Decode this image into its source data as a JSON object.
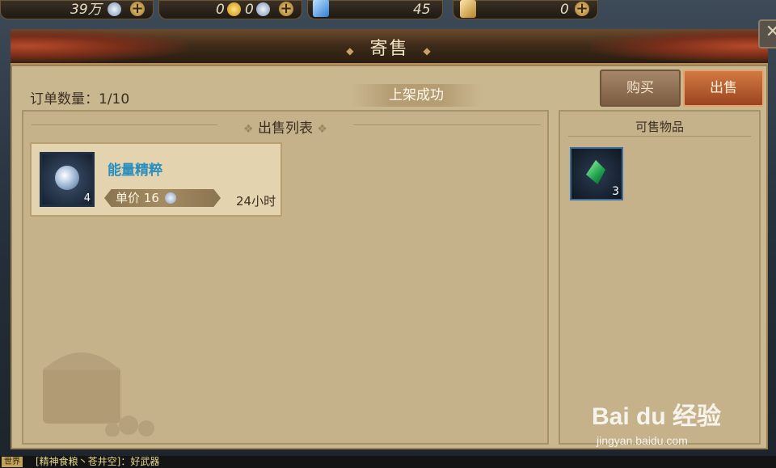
{
  "topbar": {
    "silver": "39万",
    "gold_a": "0",
    "gold_b": "0",
    "crystal": "45",
    "ticket": "0"
  },
  "window": {
    "title": "寄售",
    "close_glyph": "✕"
  },
  "orders": {
    "label": "订单数量：1/10",
    "status": "上架成功"
  },
  "tabs": {
    "buy": "购买",
    "sell": "出售"
  },
  "sell_list": {
    "header": "出售列表",
    "items": [
      {
        "name": "能量精粹",
        "count": "4",
        "price_label": "单价",
        "price": "16",
        "duration": "24小时"
      }
    ]
  },
  "available": {
    "header": "可售物品",
    "items": [
      {
        "count": "3",
        "icon": "green-crystal-icon"
      }
    ]
  },
  "chat": {
    "channel": "世界",
    "message": "[精神食粮丶苍井空]：好武器"
  },
  "watermark": {
    "brand": "Bai du 经验",
    "url": "jingyan.baidu.com"
  },
  "colors": {
    "accent": "#d27a42",
    "item_name": "#2a8fbf",
    "panel": "#c9b790"
  }
}
